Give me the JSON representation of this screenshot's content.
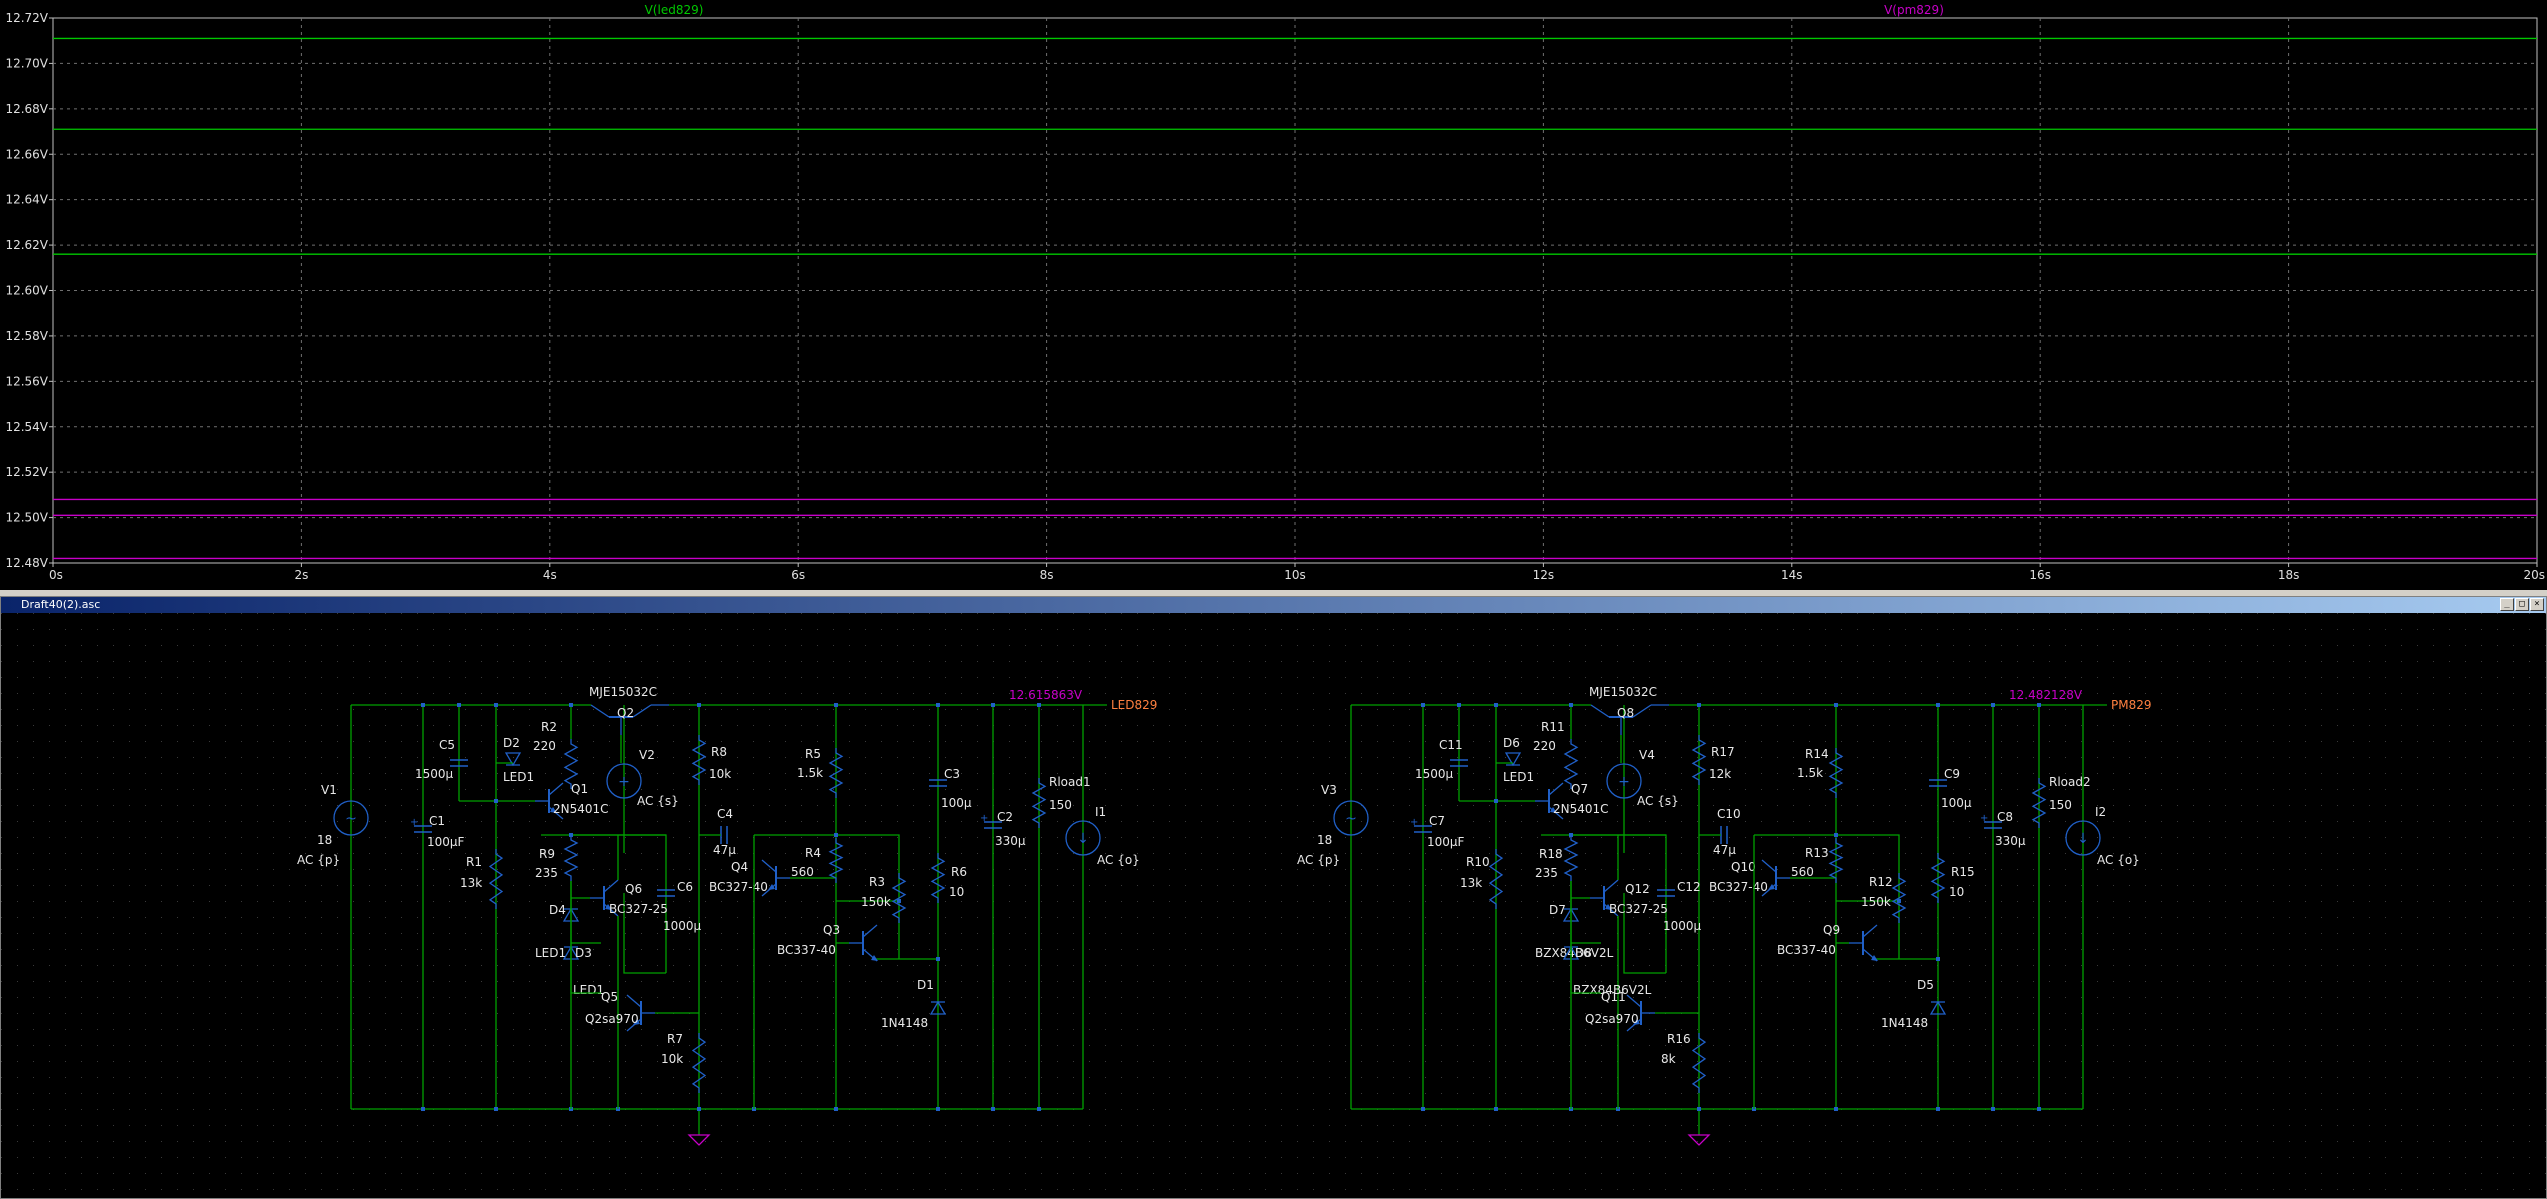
{
  "plot": {
    "trace1_label": "V(led829)",
    "trace2_label": "V(pm829)",
    "trace1_color": "#00c800",
    "trace2_color": "#c800c8",
    "y_ticks": [
      "12.72V",
      "12.70V",
      "12.68V",
      "12.66V",
      "12.64V",
      "12.62V",
      "12.60V",
      "12.58V",
      "12.56V",
      "12.54V",
      "12.52V",
      "12.50V",
      "12.48V"
    ],
    "x_ticks": [
      "0s",
      "2s",
      "4s",
      "6s",
      "8s",
      "10s",
      "12s",
      "14s",
      "16s",
      "18s",
      "20s"
    ]
  },
  "chart_data": {
    "type": "line",
    "x": [
      0,
      20
    ],
    "xlim": [
      0,
      20
    ],
    "ylim": [
      12.48,
      12.72
    ],
    "grid": true,
    "series": [
      {
        "name": "V(led829)",
        "color": "#00c800",
        "lines": [
          12.711,
          12.671,
          12.616
        ]
      },
      {
        "name": "V(pm829)",
        "color": "#c800c8",
        "lines": [
          12.508,
          12.501,
          12.482
        ]
      }
    ]
  },
  "window": {
    "title": "Draft40(2).asc",
    "btn_min": "_",
    "btn_max": "□",
    "btn_close": "×"
  },
  "schematic": {
    "colors": {
      "wire": "#00a000",
      "component": "#2060c8",
      "text": "#e8e8e8",
      "net": "#c800c8",
      "netlabel": "#ff8040"
    },
    "left": {
      "top_transistor": "MJE15032C",
      "q2": "Q2",
      "net_voltage": "12.615863V",
      "net_name": "LED829",
      "V1": "V1",
      "V1_val": "18",
      "V1_ac": "AC {p}",
      "C1": "C1",
      "C1_val": "100µF",
      "C5": "C5",
      "C5_val": "1500µ",
      "R1": "R1",
      "R1_val": "13k",
      "D2": "D2",
      "D2_model": "LED1",
      "R2": "R2",
      "R2_val": "220",
      "Q1": "Q1",
      "Q1_model": "2N5401C",
      "V2": "V2",
      "V2_ac": "AC {s}",
      "R9": "R9",
      "R9_val": "235",
      "Q6": "Q6",
      "Q6_model": "BC327-25",
      "C6": "C6",
      "C6_val": "1000µ",
      "D4": "D4",
      "D4_model": "LED1",
      "D3": "D3",
      "D3_model": "LED1",
      "Q5": "Q5",
      "Q5_model": "Q2sa970",
      "R7": "R7",
      "R7_val": "10k",
      "R8": "R8",
      "R8_val": "10k",
      "C4": "C4",
      "C4_val": "47µ",
      "Q4": "Q4",
      "Q4_model": "BC327-40",
      "R5": "R5",
      "R5_val": "1.5k",
      "R4": "R4",
      "R4_val": "560",
      "R3": "R3",
      "R3_val": "150k",
      "Q3": "Q3",
      "Q3_model": "BC337-40",
      "C3": "C3",
      "C3_val": "100µ",
      "R6": "R6",
      "R6_val": "10",
      "D1": "D1",
      "D1_model": "1N4148",
      "C2": "C2",
      "C2_val": "330µ",
      "Rload": "Rload1",
      "Rload_val": "150",
      "I": "I1",
      "I_ac": "AC {o}"
    },
    "right": {
      "top_transistor": "MJE15032C",
      "q2": "Q8",
      "net_voltage": "12.482128V",
      "net_name": "PM829",
      "V1": "V3",
      "V1_val": "18",
      "V1_ac": "AC {p}",
      "C1": "C7",
      "C1_val": "100µF",
      "C5": "C11",
      "C5_val": "1500µ",
      "R1": "R10",
      "R1_val": "13k",
      "D2": "D6",
      "D2_model": "LED1",
      "R2": "R11",
      "R2_val": "220",
      "Q1": "Q7",
      "Q1_model": "2N5401C",
      "V2": "V4",
      "V2_ac": "AC {s}",
      "R9": "R18",
      "R9_val": "235",
      "Q6": "Q12",
      "Q6_model": "BC327-25",
      "C6": "C12",
      "C6_val": "1000µ",
      "D4": "D7",
      "D4_model": "BZX84B6V2L",
      "D3": "D8",
      "D3_model": "BZX84B6V2L",
      "Q5": "Q11",
      "Q5_model": "Q2sa970",
      "R7": "R16",
      "R7_val": "8k",
      "R8": "R17",
      "R8_val": "12k",
      "C4": "C10",
      "C4_val": "47µ",
      "Q4": "Q10",
      "Q4_model": "BC327-40",
      "R5": "R14",
      "R5_val": "1.5k",
      "R4": "R13",
      "R4_val": "560",
      "R3": "R12",
      "R3_val": "150k",
      "Q3": "Q9",
      "Q3_model": "BC337-40",
      "C3": "C9",
      "C3_val": "100µ",
      "R6": "R15",
      "R6_val": "10",
      "D1": "D5",
      "D1_model": "1N4148",
      "C2": "C8",
      "C2_val": "330µ",
      "Rload": "Rload2",
      "Rload_val": "150",
      "I": "I2",
      "I_ac": "AC {o}"
    }
  }
}
